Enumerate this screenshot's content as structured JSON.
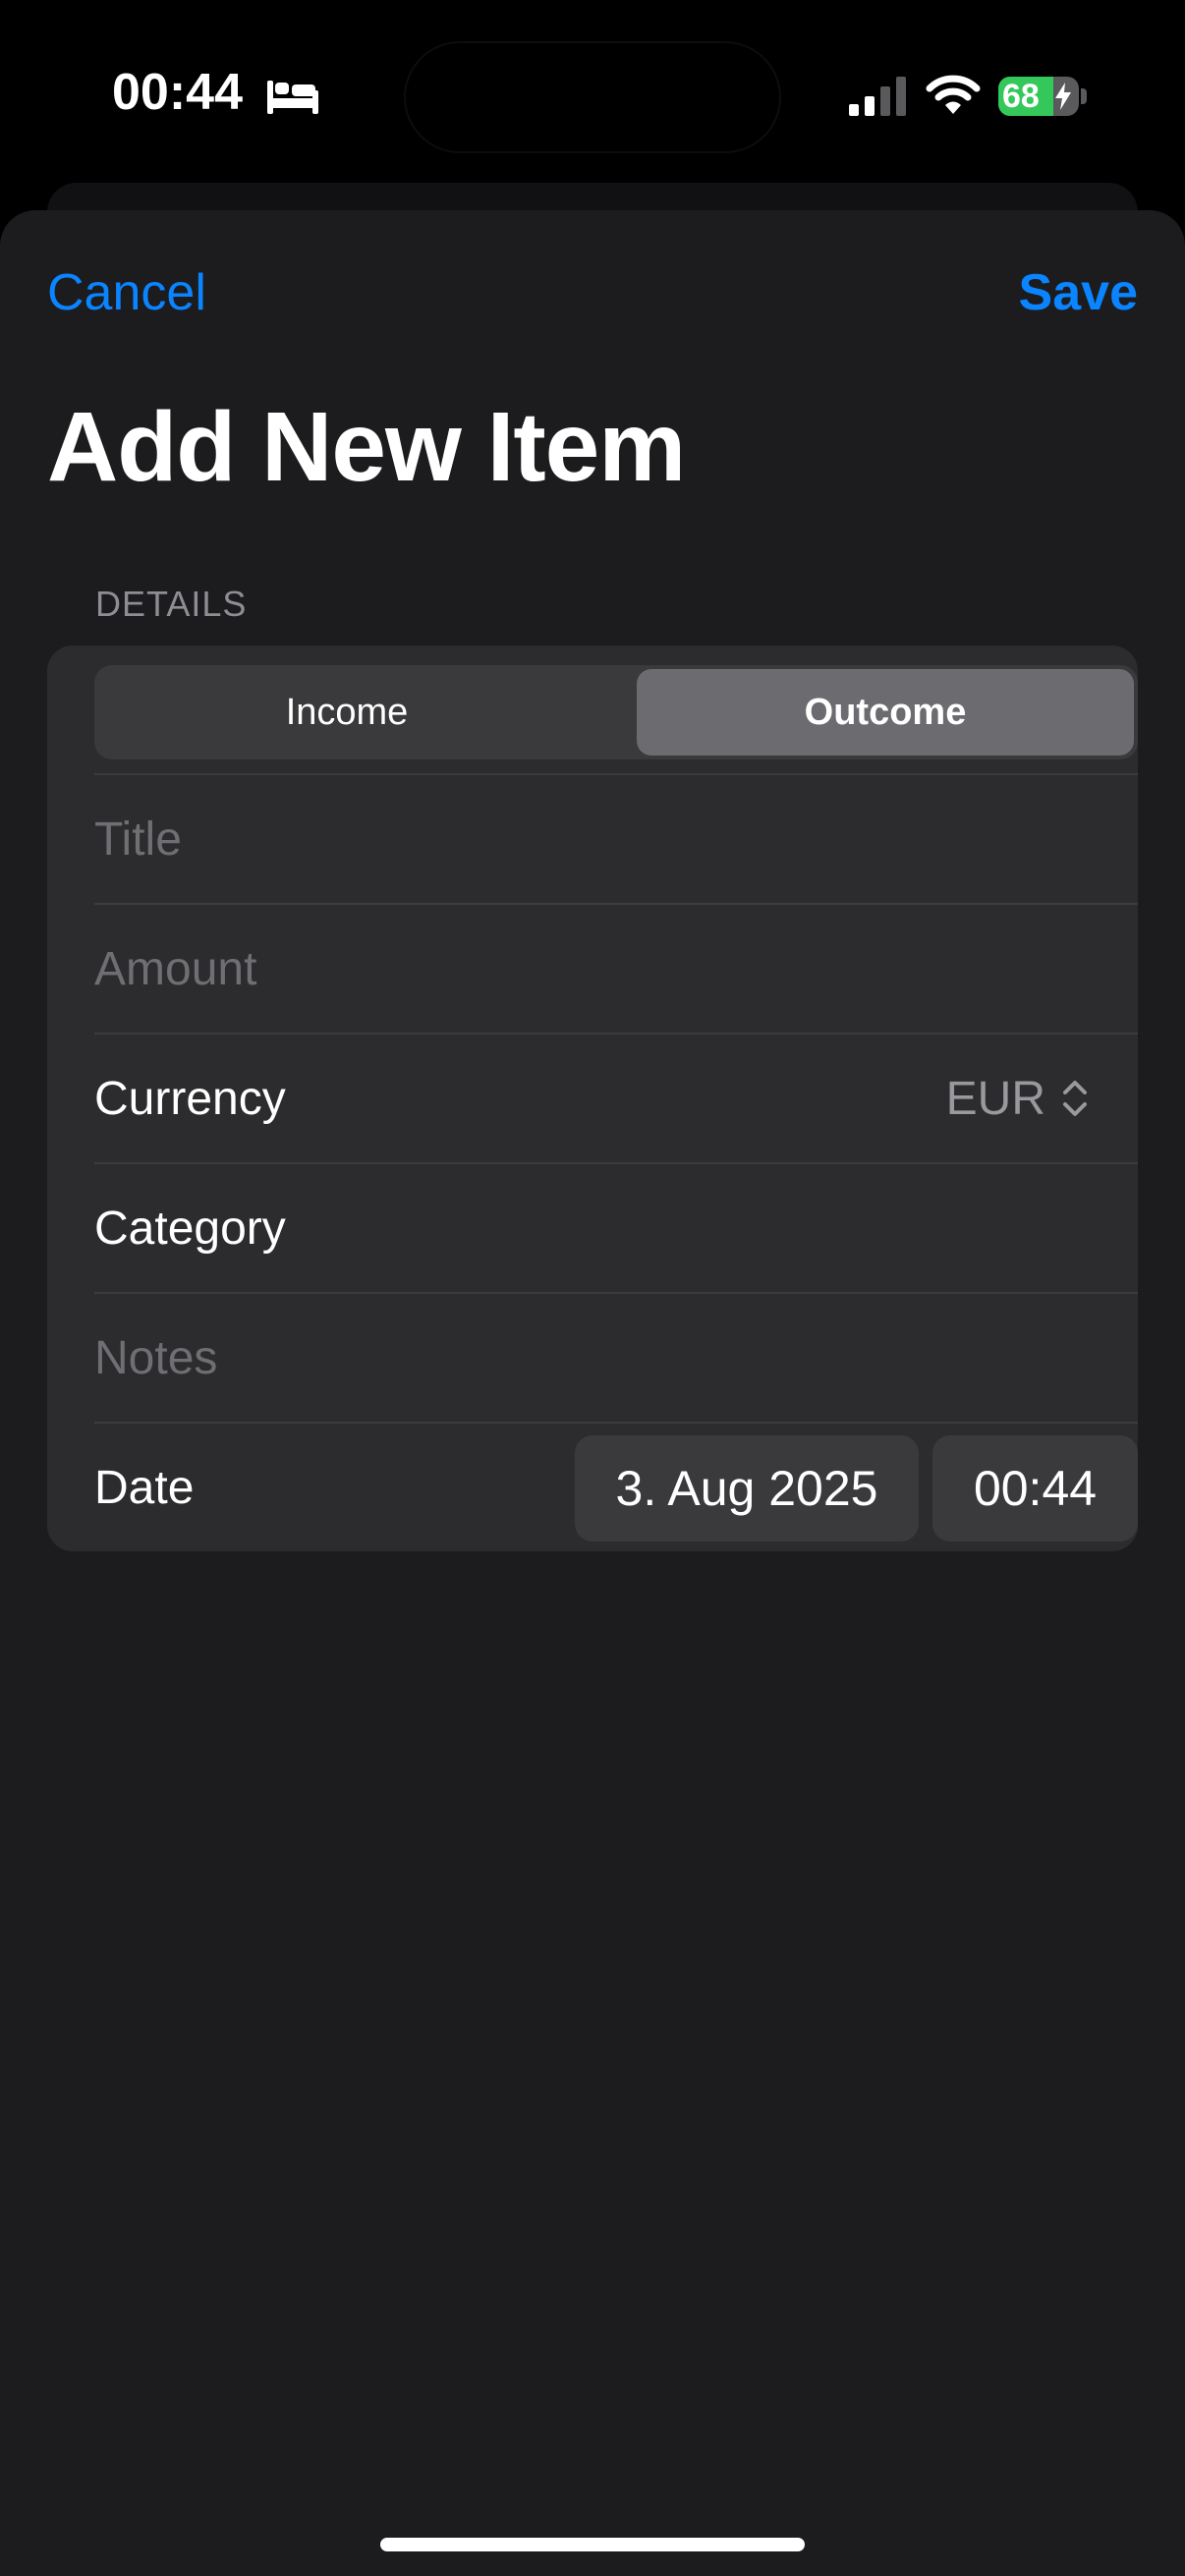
{
  "status_bar": {
    "time": "00:44",
    "focus_icon": "bed-icon",
    "signal_icon": "cellular-signal-icon",
    "wifi_icon": "wifi-icon",
    "battery_percent": "68",
    "battery_level": 0.68,
    "charging_icon": "bolt-icon"
  },
  "nav": {
    "cancel_label": "Cancel",
    "save_label": "Save"
  },
  "title": "Add New Item",
  "section": {
    "header": "DETAILS"
  },
  "segmented": {
    "options": [
      "Income",
      "Outcome"
    ],
    "selected": "Outcome"
  },
  "fields": {
    "title_placeholder": "Title",
    "amount_placeholder": "Amount",
    "currency_label": "Currency",
    "currency_value": "EUR",
    "category_label": "Category",
    "notes_placeholder": "Notes",
    "date_label": "Date",
    "date_value": "3. Aug 2025",
    "time_value": "00:44"
  },
  "colors": {
    "accent": "#0a84ff",
    "background": "#1c1c1e",
    "card": "#2c2c2e",
    "battery_fill": "#34c759"
  }
}
